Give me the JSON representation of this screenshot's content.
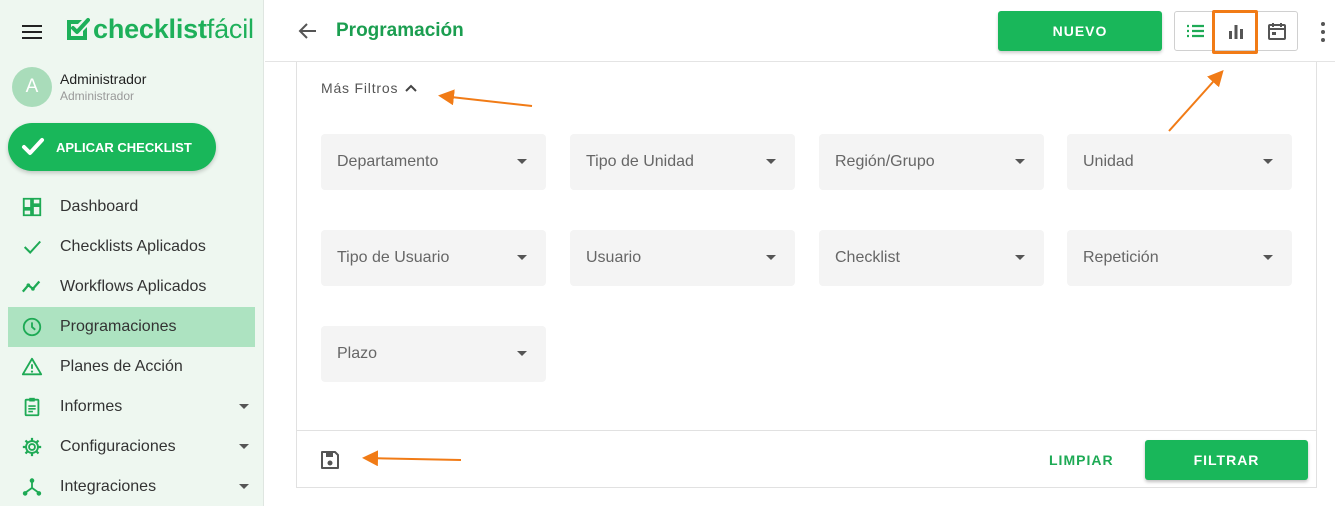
{
  "brand": {
    "name_bold": "checklist",
    "name_thin": "fácil",
    "color": "#1eb05a"
  },
  "user": {
    "initial": "A",
    "name": "Administrador",
    "role": "Administrador"
  },
  "apply_button": {
    "label": "APLICAR CHECKLIST"
  },
  "nav": {
    "items": [
      {
        "label": "Dashboard",
        "icon": "dashboard-icon",
        "active": false,
        "has_submenu": false
      },
      {
        "label": "Checklists Aplicados",
        "icon": "check-icon",
        "active": false,
        "has_submenu": false
      },
      {
        "label": "Workflows Aplicados",
        "icon": "trend-icon",
        "active": false,
        "has_submenu": false
      },
      {
        "label": "Programaciones",
        "icon": "clock-icon",
        "active": true,
        "has_submenu": false
      },
      {
        "label": "Planes de Acción",
        "icon": "warning-icon",
        "active": false,
        "has_submenu": false
      },
      {
        "label": "Informes",
        "icon": "clipboard-icon",
        "active": false,
        "has_submenu": true
      },
      {
        "label": "Configuraciones",
        "icon": "gear-icon",
        "active": false,
        "has_submenu": true
      },
      {
        "label": "Integraciones",
        "icon": "hub-icon",
        "active": false,
        "has_submenu": true
      }
    ]
  },
  "header": {
    "title": "Programación",
    "new_button": "NUEVO",
    "views": [
      {
        "icon": "list-view-icon",
        "selected": false
      },
      {
        "icon": "bar-chart-icon",
        "selected": true
      },
      {
        "icon": "calendar-icon",
        "selected": false
      }
    ]
  },
  "filters": {
    "toggle_label": "Más Filtros",
    "fields": [
      {
        "placeholder": "Departamento"
      },
      {
        "placeholder": "Tipo de Unidad"
      },
      {
        "placeholder": "Región/Grupo"
      },
      {
        "placeholder": "Unidad"
      },
      {
        "placeholder": "Tipo de Usuario"
      },
      {
        "placeholder": "Usuario"
      },
      {
        "placeholder": "Checklist"
      },
      {
        "placeholder": "Repetición"
      },
      {
        "placeholder": "Plazo"
      }
    ],
    "clear_button": "LIMPIAR",
    "filter_button": "FILTRAR"
  },
  "colors": {
    "primary": "#19b75a",
    "title_green": "#1b9e50",
    "active_nav": "#ade3c1",
    "sidebar_bg": "#eef7f0",
    "annotation": "#f17b16"
  }
}
